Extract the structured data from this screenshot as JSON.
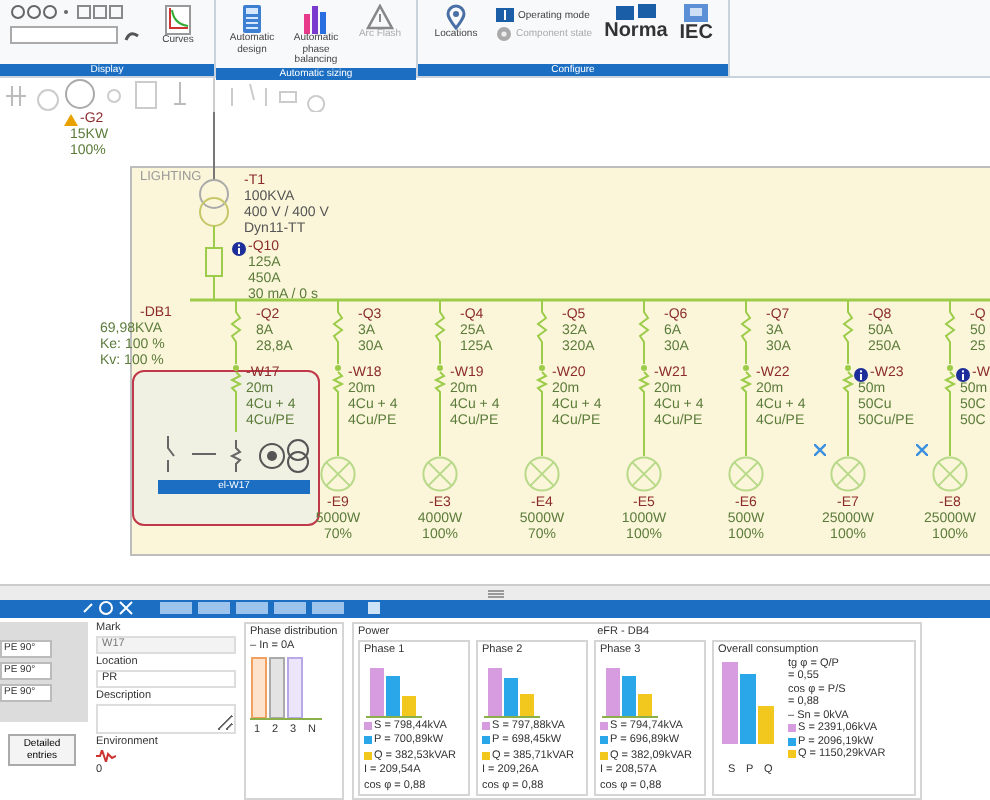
{
  "ribbon": {
    "groups": [
      {
        "label": "Display",
        "buttons": [
          {
            "label": "Curves",
            "disabled": false,
            "kind": "large"
          }
        ]
      },
      {
        "label": "Automatic sizing",
        "buttons": [
          {
            "label": "Automatic design",
            "disabled": false,
            "kind": "large"
          },
          {
            "label": "Automatic phase balancing",
            "disabled": false,
            "kind": "large"
          },
          {
            "label": "Arc Flash",
            "disabled": true,
            "kind": "large"
          }
        ]
      },
      {
        "label": "Configure",
        "buttons": [
          {
            "label": "Locations",
            "disabled": false,
            "kind": "large"
          },
          {
            "label": "Operating mode",
            "disabled": false,
            "kind": "small"
          },
          {
            "label": "Component state",
            "disabled": true,
            "kind": "small"
          },
          {
            "label": "Norma",
            "disabled": false,
            "kind": "norm"
          },
          {
            "label": "IEC",
            "disabled": false,
            "kind": "norm"
          }
        ]
      }
    ]
  },
  "diagram": {
    "source": {
      "name": "-G2",
      "power": "15KW",
      "percent": "100%"
    },
    "panel": {
      "label": "LIGHTING"
    },
    "transformer": {
      "name": "-T1",
      "rating": "100KVA",
      "voltage": "400 V / 400 V",
      "coupling": "Dyn11-TT"
    },
    "main_breaker": {
      "name": "-Q10",
      "rating": "125A",
      "setting": "450A",
      "residual": "30 mA / 0 s"
    },
    "board": {
      "name": "-DB1",
      "power": "69,98KVA",
      "ke": "Ke: 100 %",
      "kv": "Kv: 100 %"
    },
    "feeders": [
      {
        "selected": true,
        "breaker": {
          "name": "-Q2",
          "rating": "8A",
          "setting": "28,8A"
        },
        "cable": {
          "name": "-W17",
          "length": "20m",
          "phases": "4Cu + 4",
          "pe": "4Cu/PE",
          "info": false
        }
      },
      {
        "selected": false,
        "breaker": {
          "name": "-Q3",
          "rating": "3A",
          "setting": "30A"
        },
        "cable": {
          "name": "-W18",
          "length": "20m",
          "phases": "4Cu + 4",
          "pe": "4Cu/PE",
          "info": false
        },
        "load": {
          "name": "-E9",
          "power": "5000W",
          "percent": "70%",
          "crossed": false
        }
      },
      {
        "selected": false,
        "breaker": {
          "name": "-Q4",
          "rating": "25A",
          "setting": "125A"
        },
        "cable": {
          "name": "-W19",
          "length": "20m",
          "phases": "4Cu + 4",
          "pe": "4Cu/PE",
          "info": false
        },
        "load": {
          "name": "-E3",
          "power": "4000W",
          "percent": "100%",
          "crossed": false
        }
      },
      {
        "selected": false,
        "breaker": {
          "name": "-Q5",
          "rating": "32A",
          "setting": "320A"
        },
        "cable": {
          "name": "-W20",
          "length": "20m",
          "phases": "4Cu + 4",
          "pe": "4Cu/PE",
          "info": false
        },
        "load": {
          "name": "-E4",
          "power": "5000W",
          "percent": "70%",
          "crossed": false
        }
      },
      {
        "selected": false,
        "breaker": {
          "name": "-Q6",
          "rating": "6A",
          "setting": "30A"
        },
        "cable": {
          "name": "-W21",
          "length": "20m",
          "phases": "4Cu + 4",
          "pe": "4Cu/PE",
          "info": false
        },
        "load": {
          "name": "-E5",
          "power": "1000W",
          "percent": "100%",
          "crossed": false
        }
      },
      {
        "selected": false,
        "breaker": {
          "name": "-Q7",
          "rating": "3A",
          "setting": "30A"
        },
        "cable": {
          "name": "-W22",
          "length": "20m",
          "phases": "4Cu + 4",
          "pe": "4Cu/PE",
          "info": false
        },
        "load": {
          "name": "-E6",
          "power": "500W",
          "percent": "100%",
          "crossed": false
        }
      },
      {
        "selected": false,
        "breaker": {
          "name": "-Q8",
          "rating": "50A",
          "setting": "250A"
        },
        "cable": {
          "name": "-W23",
          "length": "50m",
          "phases": "50Cu",
          "pe": "50Cu/PE",
          "info": true
        },
        "load": {
          "name": "-E7",
          "power": "25000W",
          "percent": "100%",
          "crossed": true
        }
      },
      {
        "selected": false,
        "breaker": {
          "name": "-Q",
          "rating": "50",
          "setting": "25"
        },
        "cable": {
          "name": "-W",
          "length": "50m",
          "phases": "50C",
          "pe": "50C",
          "info": true
        },
        "load": {
          "name": "-E8",
          "power": "25000W",
          "percent": "100%",
          "crossed": true
        }
      }
    ],
    "popup": {
      "label": "el-W17"
    }
  },
  "properties": {
    "dropdowns": [
      "PE 90°",
      "PE 90°",
      "PE 90°"
    ],
    "detail_button": "Detailed entries",
    "fields": [
      {
        "label": "Mark",
        "value": "W17",
        "disabled": true
      },
      {
        "label": "Location",
        "value": "PR",
        "disabled": false
      },
      {
        "label": "Description",
        "disabled": false
      }
    ],
    "environment": {
      "label": "Environment",
      "value": "0"
    },
    "phase_distribution": {
      "title": "Phase distribution",
      "note": "– In = 0A",
      "bars": [
        "1",
        "2",
        "3",
        "N"
      ]
    },
    "power": {
      "title": "Power",
      "group_label": "eFR - DB4",
      "phases": [
        {
          "title": "Phase 1",
          "lines": [
            "S = 798,44kVA",
            "P = 700,89kW",
            "Q = 382,53kVAR",
            "I = 209,54A",
            "cos φ = 0,88"
          ]
        },
        {
          "title": "Phase 2",
          "lines": [
            "S = 797,88kVA",
            "P = 698,45kW",
            "Q = 385,71kVAR",
            "I = 209,26A",
            "cos φ = 0,88"
          ]
        },
        {
          "title": "Phase 3",
          "lines": [
            "S = 794,74kVA",
            "P = 696,89kW",
            "Q = 382,09kVAR",
            "I = 208,57A",
            "cos φ = 0,88"
          ]
        }
      ]
    },
    "overall": {
      "title": "Overall consumption",
      "formulas": [
        "tg φ = Q/P",
        "= 0,55",
        "cos φ = P/S",
        "= 0,88",
        "– Sn = 0kVA"
      ],
      "lines": [
        "S = 2391,06kVA",
        "P = 2096,19kW",
        "Q = 1150,29kVAR"
      ],
      "bar_labels": [
        "S",
        "P",
        "Q"
      ]
    }
  }
}
